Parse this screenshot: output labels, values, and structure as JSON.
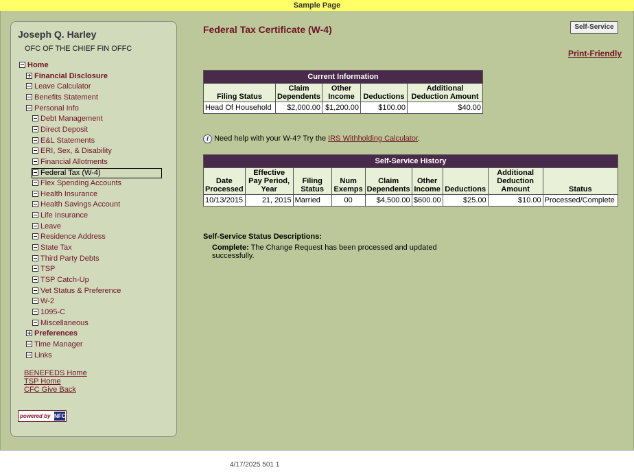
{
  "header": {
    "title": "Sample Page"
  },
  "user": {
    "name": "Joseph Q. Harley",
    "org": "OFC OF THE CHIEF FIN OFFC"
  },
  "nav": [
    {
      "label": "Home",
      "level": 0,
      "expanded": true,
      "bold": true
    },
    {
      "label": "Financial Disclosure",
      "level": 1,
      "expanded": false,
      "bold": true,
      "plus": true
    },
    {
      "label": "Leave Calculator",
      "level": 1
    },
    {
      "label": "Benefits Statement",
      "level": 1
    },
    {
      "label": "Personal Info",
      "level": 1,
      "expanded": true
    },
    {
      "label": "Debt Management",
      "level": 2
    },
    {
      "label": "Direct Deposit",
      "level": 2
    },
    {
      "label": "E&L Statements",
      "level": 2
    },
    {
      "label": "ERI, Sex, & Disability",
      "level": 2
    },
    {
      "label": "Financial Allotments",
      "level": 2
    },
    {
      "label": "Federal Tax (W-4)",
      "level": 2,
      "selected": true
    },
    {
      "label": "Flex Spending Accounts",
      "level": 2
    },
    {
      "label": "Health Insurance",
      "level": 2
    },
    {
      "label": "Health Savings Account",
      "level": 2
    },
    {
      "label": "Life Insurance",
      "level": 2
    },
    {
      "label": "Leave",
      "level": 2
    },
    {
      "label": "Residence Address",
      "level": 2
    },
    {
      "label": "State Tax",
      "level": 2
    },
    {
      "label": "Third Party Debts",
      "level": 2
    },
    {
      "label": "TSP",
      "level": 2
    },
    {
      "label": "TSP Catch-Up",
      "level": 2
    },
    {
      "label": "Vet Status & Preference",
      "level": 2
    },
    {
      "label": "W-2",
      "level": 2
    },
    {
      "label": "1095-C",
      "level": 2
    },
    {
      "label": "Miscellaneous",
      "level": 2
    },
    {
      "label": "Preferences",
      "level": 1,
      "bold": true,
      "plus": true
    },
    {
      "label": "Time Manager",
      "level": 1
    },
    {
      "label": "Links",
      "level": 1
    }
  ],
  "bottom_links": [
    "BENEFEDS Home",
    "TSP Home",
    "CFC Give Back"
  ],
  "powered_by": {
    "label": "powered by",
    "logo": "NFC"
  },
  "main": {
    "title": "Federal Tax Certificate (W-4)",
    "self_service_button": "Self-Service",
    "print_link": "Print-Friendly",
    "current": {
      "caption": "Current Information",
      "headers": [
        "Filing Status",
        "Claim Dependents",
        "Other Income",
        "Deductions",
        "Additional Deduction Amount"
      ],
      "row": [
        "Head Of Household",
        "$2,000.00",
        "$1,200.00",
        "$100.00",
        "$40.00"
      ]
    },
    "help": {
      "icon": "info-icon",
      "text": "Need help with your W-4? Try the ",
      "link": "IRS Withholding Calculator",
      "after": "."
    },
    "history": {
      "caption": "Self-Service History",
      "headers": [
        "Date Processed",
        "Effective Pay Period, Year",
        "Filing Status",
        "Num Exemps",
        "Claim Dependents",
        "Other Income",
        "Deductions",
        "Additional Deduction Amount",
        "Status"
      ],
      "row": [
        "10/13/2015",
        "21, 2015",
        "Married",
        "00",
        "$4,500.00",
        "$600.00",
        "$25.00",
        "$10.00",
        "Processed/Complete"
      ]
    },
    "status_desc": {
      "heading": "Self-Service Status Descriptions:",
      "term": "Complete:",
      "text": " The Change Request has been processed and updated successfully."
    }
  },
  "footer": {
    "text": "4/17/2025 501 1"
  },
  "colors": {
    "accent": "#6e1424",
    "table_header": "#4a2a4a",
    "page_bg": "#bcc899",
    "topbar": "#ffff66"
  }
}
